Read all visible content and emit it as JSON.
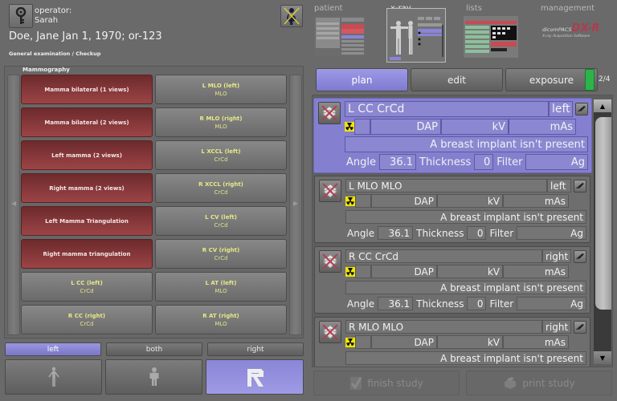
{
  "header": {
    "operator_label": "operator:",
    "operator_name": "Sarah",
    "patient": "Doe,  Jane  Jan 1, 1970; or-123",
    "exam": "General examination / Checkup",
    "key_icon": "key-icon",
    "pregnancy_icon": "pregnancy-crossed-icon"
  },
  "nav": {
    "items": [
      {
        "label": "patient",
        "active": false
      },
      {
        "label": "x-ray",
        "active": true
      },
      {
        "label": "lists",
        "active": false
      },
      {
        "label": "management",
        "active": false
      }
    ],
    "logo": {
      "line1_prefix": "dicomPACS",
      "line1_brand": "DX-R",
      "line2": "X-ray Acquisition Software"
    }
  },
  "procedures": {
    "group_title": "Mammography",
    "left_column": [
      {
        "label": "Mamma bilateral (1 views)"
      },
      {
        "label": "Mamma bilateral (2 views)"
      },
      {
        "label": "Left mamma (2 views)"
      },
      {
        "label": "Right mamma (2 views)"
      },
      {
        "label": "Left Mamma Triangulation"
      },
      {
        "label": "Right mamma triangulation"
      },
      {
        "label": "L CC (left)",
        "sub": "CrCd"
      },
      {
        "label": "R CC (right)",
        "sub": "CrCd"
      }
    ],
    "right_column": [
      {
        "label": "L MLO (left)",
        "sub": "MLO"
      },
      {
        "label": "R MLO (right)",
        "sub": "MLO"
      },
      {
        "label": "L XCCL (left)",
        "sub": "CrCd"
      },
      {
        "label": "R XCCL (right)",
        "sub": "CrCd"
      },
      {
        "label": "L CV (left)",
        "sub": "CrCd"
      },
      {
        "label": "R CV (right)",
        "sub": "CrCd"
      },
      {
        "label": "L AT (left)",
        "sub": "MLO"
      },
      {
        "label": "R AT (right)",
        "sub": "MLO"
      }
    ]
  },
  "side_tabs": [
    {
      "label": "left",
      "active": true
    },
    {
      "label": "both",
      "active": false
    },
    {
      "label": "right",
      "active": false
    }
  ],
  "body_views": [
    {
      "icon": "body-front-icon",
      "active": false
    },
    {
      "icon": "body-child-icon",
      "active": false
    },
    {
      "icon": "letter-r-icon",
      "active": true
    }
  ],
  "steps": {
    "tabs": [
      {
        "label": "plan",
        "active": true
      },
      {
        "label": "edit",
        "active": false
      },
      {
        "label": "exposure",
        "active": false
      }
    ],
    "count": "2/4",
    "indicator_color": "#2db34a"
  },
  "exposures": [
    {
      "title": "L CC CrCd",
      "side": "left",
      "dap": "DAP",
      "kv": "kV",
      "mas": "mAs",
      "note": "A breast implant isn't present",
      "angle_label": "Angle",
      "angle": "36.1",
      "thickness_label": "Thickness",
      "thickness": "0",
      "filter_label": "Filter",
      "filter": "Ag",
      "active": true
    },
    {
      "title": "L MLO MLO",
      "side": "left",
      "dap": "DAP",
      "kv": "kV",
      "mas": "mAs",
      "note": "A breast implant isn't present",
      "angle_label": "Angle",
      "angle": "36.1",
      "thickness_label": "Thickness",
      "thickness": "0",
      "filter_label": "Filter",
      "filter": "Ag",
      "active": false
    },
    {
      "title": "R CC CrCd",
      "side": "right",
      "dap": "DAP",
      "kv": "kV",
      "mas": "mAs",
      "note": "A breast implant isn't present",
      "angle_label": "Angle",
      "angle": "36.1",
      "thickness_label": "Thickness",
      "thickness": "0",
      "filter_label": "Filter",
      "filter": "Ag",
      "active": false
    },
    {
      "title": "R MLO MLO",
      "side": "right",
      "dap": "DAP",
      "kv": "kV",
      "mas": "mAs",
      "note": "A breast implant isn't present",
      "active": false
    }
  ],
  "actions": {
    "finish": "finish study",
    "print": "print study"
  },
  "colors": {
    "accent": "#8480cf",
    "procedure_red": "#8a3638",
    "radiation_yellow": "#f2e600"
  }
}
